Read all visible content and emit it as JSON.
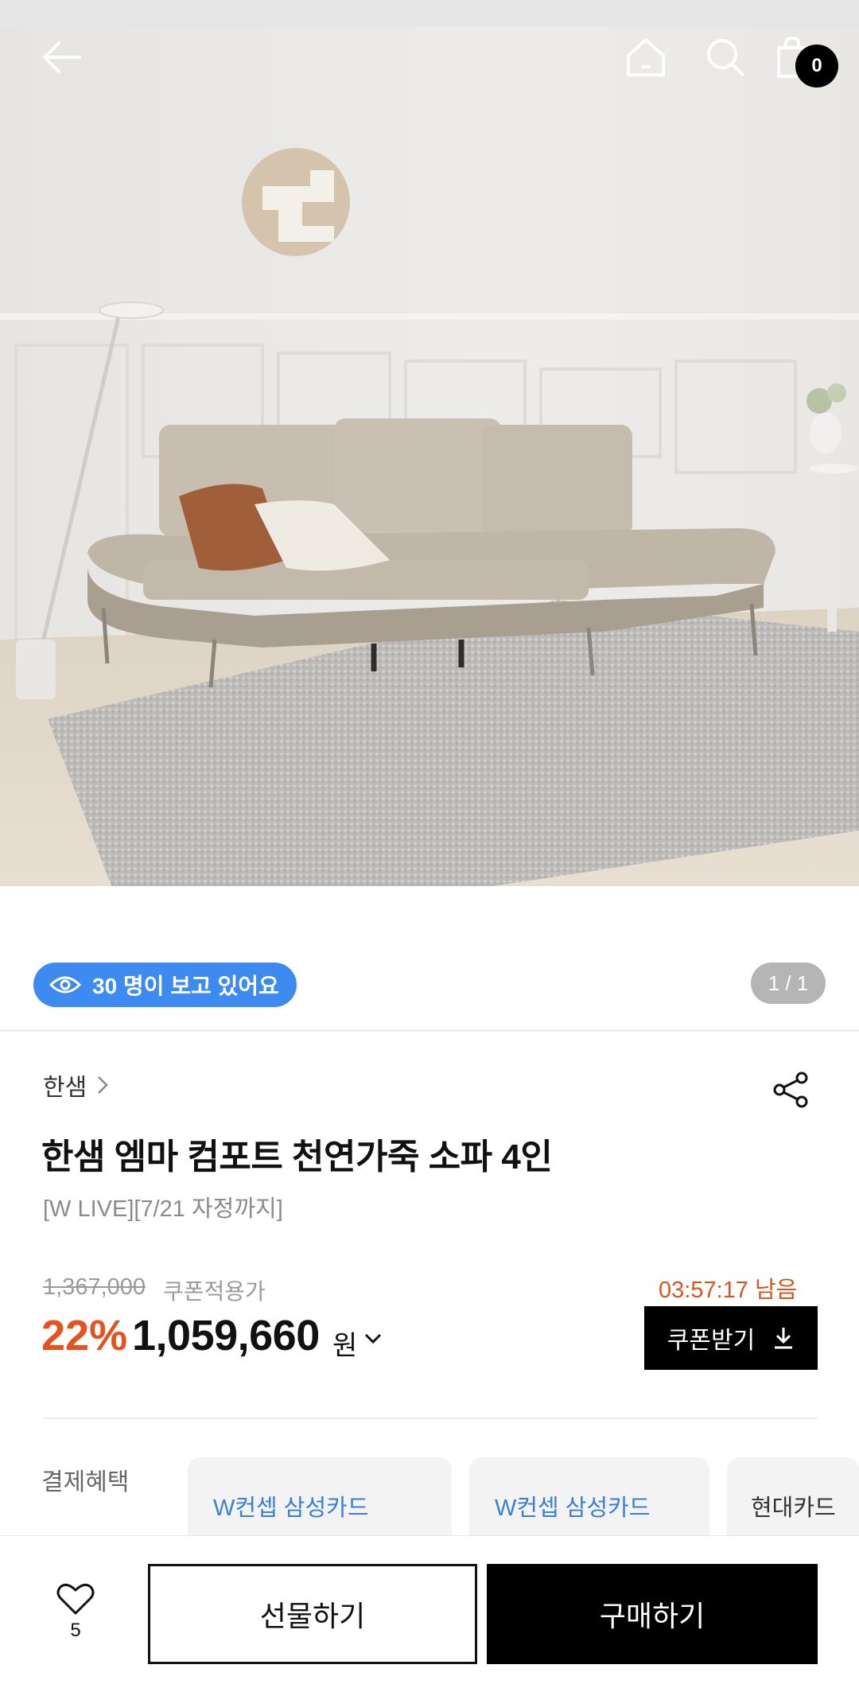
{
  "header": {
    "icons": [
      "back-arrow-icon",
      "home-icon",
      "search-icon",
      "shopping-bag-icon"
    ],
    "cart_count": "0"
  },
  "gallery": {
    "viewers_text": "30 명이 보고 있어요",
    "pager": "1 / 1"
  },
  "product": {
    "brand": "한샘",
    "title": "한샘 엠마 컴포트 천연가죽 소파 4인",
    "subtitle": "[W LIVE][7/21 자정까지]",
    "original_price": "1,367,000",
    "coupon_label": "쿠폰적용가",
    "discount": "22%",
    "price": "1,059,660",
    "currency": "원",
    "timer": "03:57:17 남음",
    "coupon_button": "쿠폰받기"
  },
  "benefits": {
    "label": "결제혜택",
    "cards": [
      "W컨셉 삼성카드",
      "W컨셉 삼성카드",
      "현대카드"
    ]
  },
  "bottom_bar": {
    "like_count": "5",
    "gift_label": "선물하기",
    "buy_label": "구매하기"
  },
  "colors": {
    "accent_orange": "#e4531f",
    "badge_blue": "#3d8bf0",
    "card_link_blue": "#3a7fd5"
  }
}
